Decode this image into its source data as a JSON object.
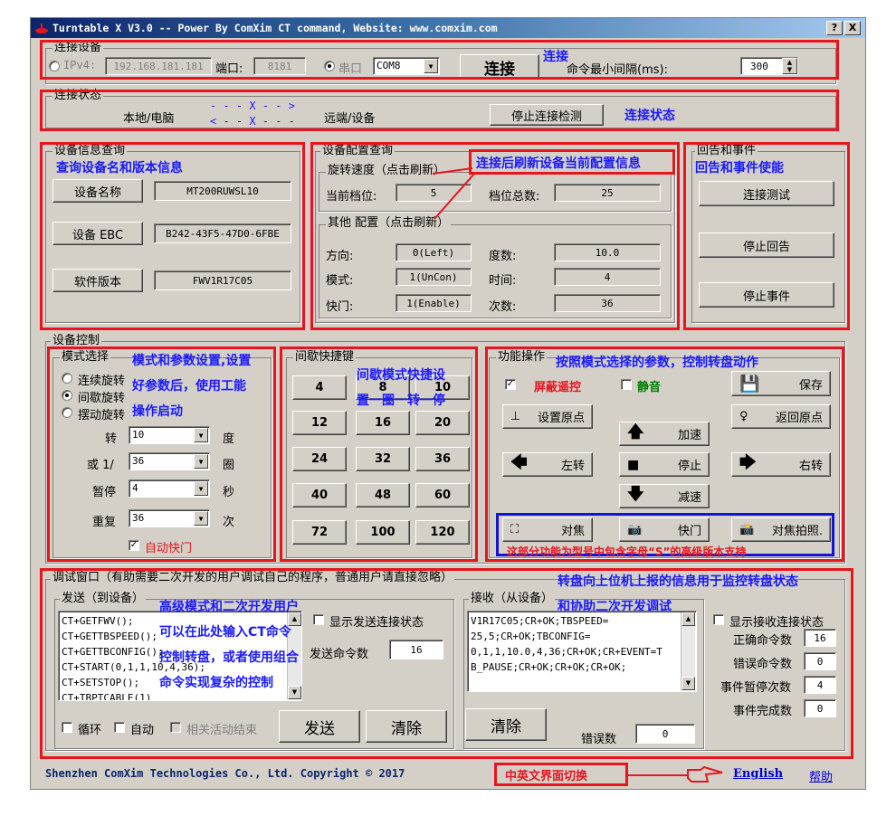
{
  "window": {
    "title": "Turntable X  V3.0 -- Power By ComXim CT command, Website: www.comxim.com",
    "help_btn": "?",
    "close_btn": "X"
  },
  "connect": {
    "group": "连接设备",
    "ipv4_label": "IPv4:",
    "ip": "192.168.181.181",
    "port_label": "端口:",
    "port": "8181",
    "serial_label": "串口",
    "com": "COM8",
    "connect_btn": "连接",
    "interval_label": "命令最小间隔(ms):",
    "interval": "300",
    "anno": "连接"
  },
  "status": {
    "group": "连接状态",
    "local": "本地/电脑",
    "arrow_right": "- - - X - - >",
    "arrow_left": "< - - X - - -",
    "remote": "远端/设备",
    "stop_btn": "停止连接检测",
    "anno": "连接状态"
  },
  "info": {
    "group": "设备信息查询",
    "anno": "查询设备名和版本信息",
    "name_btn": "设备名称",
    "name": "MT200RUWSL10",
    "ebc_btn": "设备 EBC",
    "ebc": "B242-43F5-47D0-6FBE",
    "sw_btn": "软件版本",
    "sw": "FWV1R17C05"
  },
  "config": {
    "group": "设备配置查询",
    "anno": "连接后刷新设备当前配置信息",
    "speed_group": "旋转速度（点击刷新）",
    "cur_gear_label": "当前档位:",
    "cur_gear": "5",
    "total_gear_label": "档位总数:",
    "total_gear": "25",
    "other_group": "其他 配置（点击刷新）",
    "dir_label": "方向:",
    "dir": "0(Left)",
    "deg_label": "度数:",
    "deg": "10.0",
    "mode_label": "模式:",
    "mode": "1(UnCon)",
    "time_label": "时间:",
    "time": "4",
    "shutter_label": "快门:",
    "shutter": "1(Enable)",
    "count_label": "次数:",
    "count": "36"
  },
  "echo": {
    "group": "回告和事件",
    "anno": "回告和事件使能",
    "test_btn": "连接测试",
    "stop_echo_btn": "停止回告",
    "stop_event_btn": "停止事件"
  },
  "control": {
    "group": "设备控制",
    "mode_group": "模式选择",
    "anno1": "模式和参数设置,设置",
    "anno2": "好参数后，使用工能",
    "anno3": "操作启动",
    "modes": [
      "连续旋转",
      "间歇旋转",
      "摆动旋转"
    ],
    "turn_label": "转",
    "turn": "10",
    "turn_unit": "度",
    "or_label": "或 1/",
    "or_val": "36",
    "or_unit": "圈",
    "pause_label": "暂停",
    "pause": "4",
    "pause_unit": "秒",
    "repeat_label": "重复",
    "repeat": "36",
    "repeat_unit": "次",
    "auto_shutter": "自动快门"
  },
  "quick": {
    "group": "间歇快捷键",
    "anno1": "间歇模式快捷设",
    "anno2": "置一圈一转一停",
    "keys": [
      "4",
      "8",
      "10",
      "12",
      "16",
      "20",
      "24",
      "32",
      "36",
      "40",
      "48",
      "60",
      "72",
      "100",
      "120"
    ]
  },
  "func": {
    "group": "功能操作",
    "anno": "按照模式选择的参数，控制转盘动作",
    "mask_remote": "屏蔽遥控",
    "mute": "静音",
    "save": "保存",
    "set_origin": "设置原点",
    "return_origin": "返回原点",
    "accel": "加速",
    "left": "左转",
    "stop": "停止",
    "right": "右转",
    "decel": "减速",
    "focus": "对焦",
    "shutter": "快门",
    "focus_shot": "对焦拍照.",
    "adv_anno": "这部分功能为型号中包含字母“S”的高级版本支持"
  },
  "debug": {
    "group": "调试窗口（有助需要二次开发的用户调试自己的程序，普通用户请直接忽略）",
    "anno_top1": "转盘向上位机上报的信息用于监控转盘状态",
    "anno_top2": "和协助二次开发调试",
    "send_group": "发送（到设备）",
    "send_lines": "CT+GETFWV();\nCT+GETTBSPEED();\nCT+GETTBCONFIG();\nCT+START(0,1,1,10,4,36);\nCT+SETSTOP();\nCT+TBPTCABLE(1)",
    "anno_send1": "高级模式和二次开发用户",
    "anno_send2": "可以在此处输入CT命令",
    "anno_send3": "控制转盘，或者使用组合",
    "anno_send4": "命令实现复杂的控制",
    "show_send_status": "显示发送连接状态",
    "send_count_label": "发送命令数",
    "send_count": "16",
    "loop": "循环",
    "auto": "自动",
    "related_end": "相关活动结束",
    "send_btn": "发送",
    "clear_btn": "清除",
    "recv_group": "接收（从设备）",
    "recv_lines": "V1R17C05;CR+OK;TBSPEED=\n25,5;CR+OK;TBCONFIG=\n0,1,1,10.0,4,36;CR+OK;CR+EVENT=T\nB_PAUSE;CR+OK;CR+OK;CR+OK;",
    "recv_clear_btn": "清除",
    "err_label": "错误数",
    "err": "0",
    "show_recv_status": "显示接收连接状态",
    "ok_label": "正确命令数",
    "ok": "16",
    "bad_label": "错误命令数",
    "bad": "0",
    "pause_label": "事件暂停次数",
    "pause": "4",
    "done_label": "事件完成数",
    "done": "0"
  },
  "footer": {
    "copyright": "Shenzhen ComXim Technologies Co., Ltd. Copyright © 2017",
    "lang_anno": "中英文界面切换",
    "english": "English",
    "help": "帮助"
  },
  "colors": {
    "annotation_red": "#e8141e",
    "annotation_blue": "#1a1aff",
    "title_bar": "#0a246a"
  }
}
